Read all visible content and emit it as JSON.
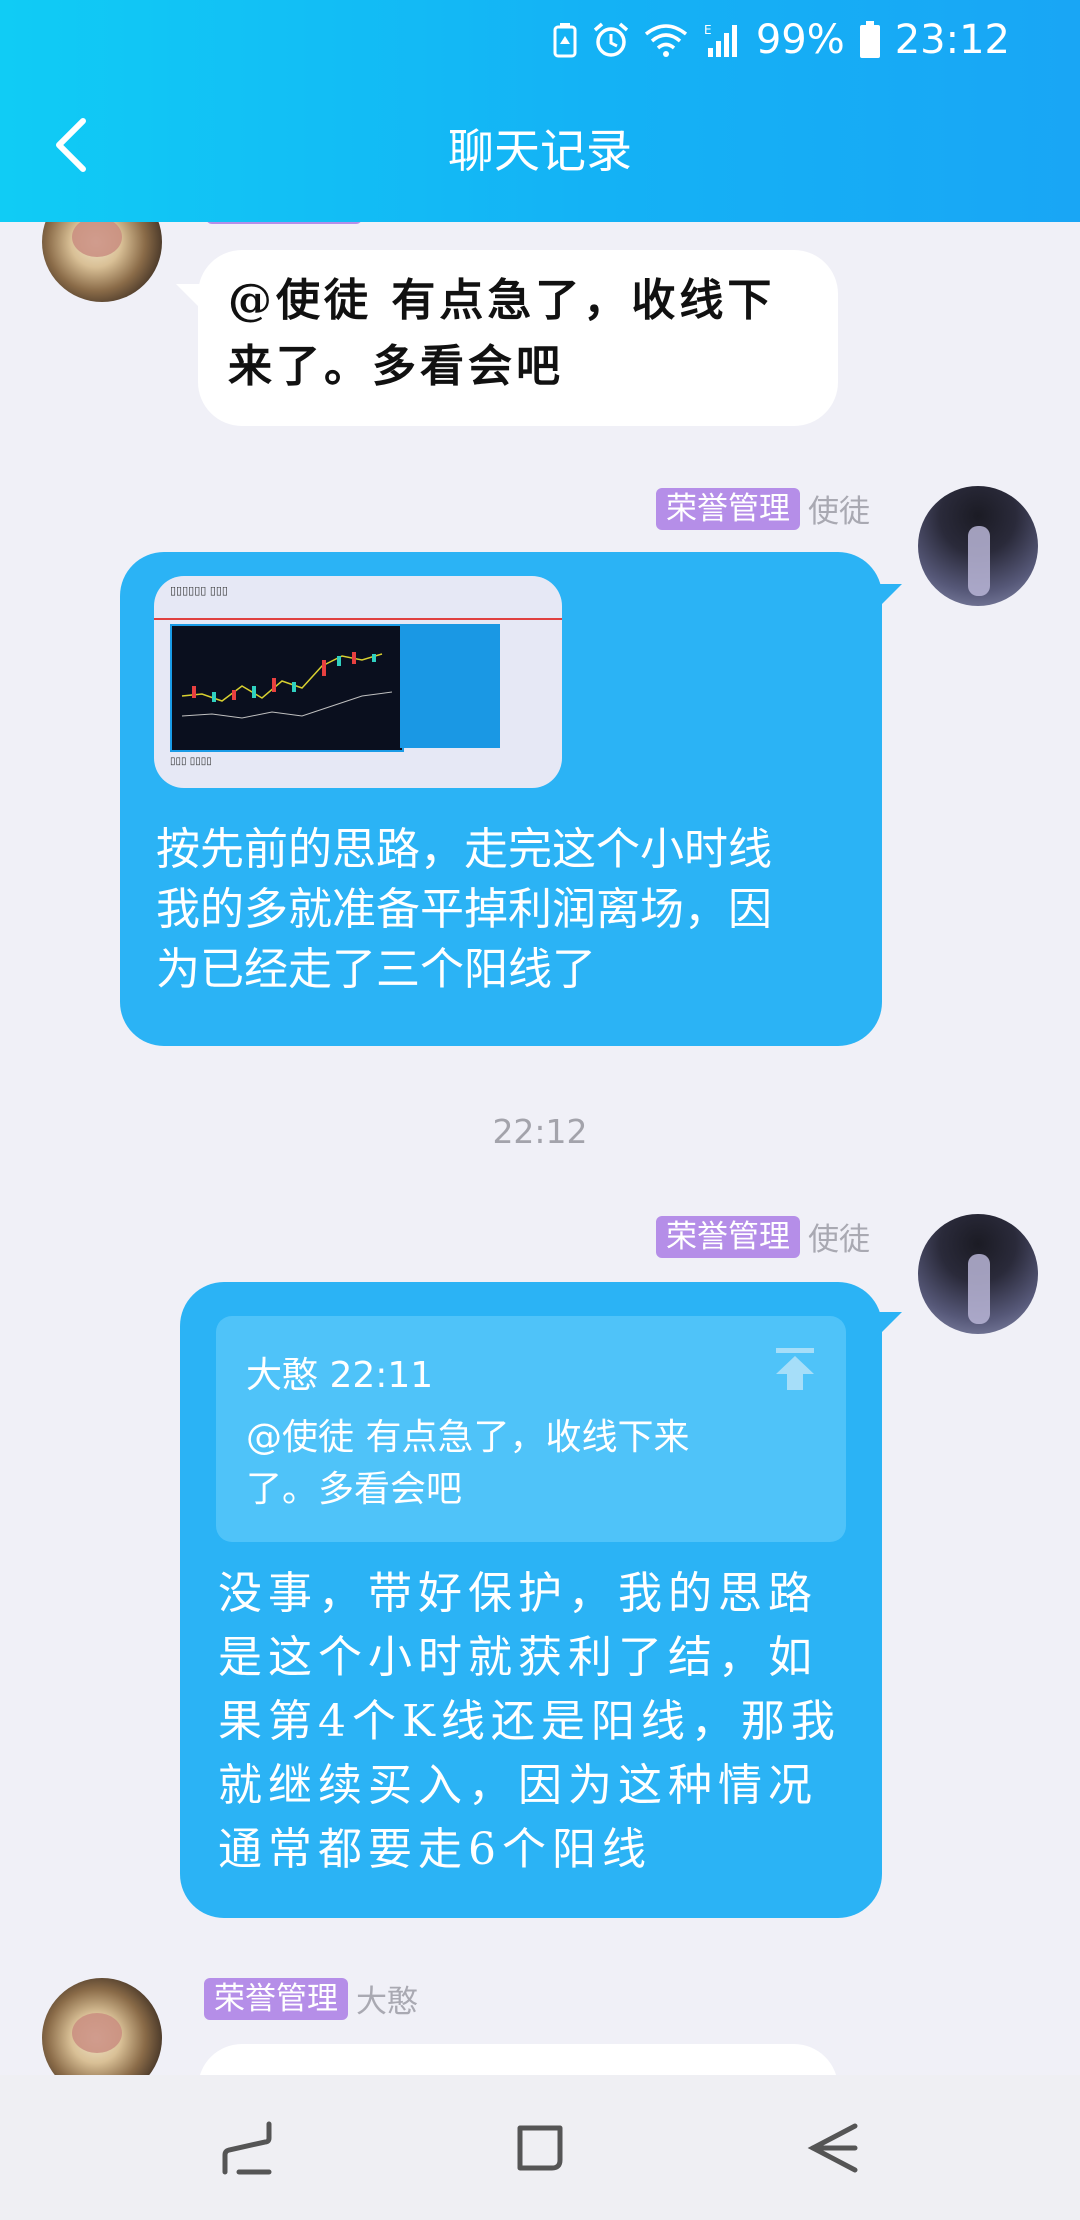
{
  "status_bar": {
    "battery_percent": "99%",
    "time": "23:12",
    "icons": [
      "battery-saver-icon",
      "alarm-icon",
      "wifi-icon",
      "signal-icon",
      "battery-icon"
    ],
    "network_type": "E"
  },
  "header": {
    "title": "聊天记录",
    "back_icon": "chevron-left-icon"
  },
  "messages": [
    {
      "id": "m1",
      "side": "left",
      "avatar": "avatar-daohan",
      "text_lines": [
        "@使徒 有点急了，收线下",
        "来了。多看会吧"
      ]
    },
    {
      "id": "m2",
      "side": "right",
      "badge": "荣誉管理",
      "sender": "使徒",
      "has_image": true,
      "text_lines": [
        "按先前的思路，走完这个小时线",
        "我的多就准备平掉利润离场，因",
        "为已经走了三个阳线了"
      ]
    },
    {
      "id": "m3",
      "side": "right",
      "badge": "荣誉管理",
      "sender": "使徒",
      "quote": {
        "author_time": "大憨 22:11",
        "lines": [
          "@使徒 有点急了，收线下来",
          "了。多看会吧"
        ]
      },
      "text_lines": [
        "没事，带好保护，我的思路",
        "是这个小时就获利了结，如",
        "果第4个K线还是阳线，那我",
        "就继续买入，因为这种情况",
        "通常都要走6个阳线"
      ]
    },
    {
      "id": "m4",
      "side": "left",
      "badge": "荣誉管理",
      "sender": "大憨"
    }
  ],
  "timestamp": "22:12",
  "colors": {
    "header_start": "#10ccf5",
    "header_end": "#19a6f5",
    "bubble_blue": "#2bb3f5",
    "badge": "#b58ee8",
    "background": "#f0f0f7"
  },
  "nav_bar": {
    "items": [
      "recents-icon",
      "home-icon",
      "back-icon"
    ]
  }
}
